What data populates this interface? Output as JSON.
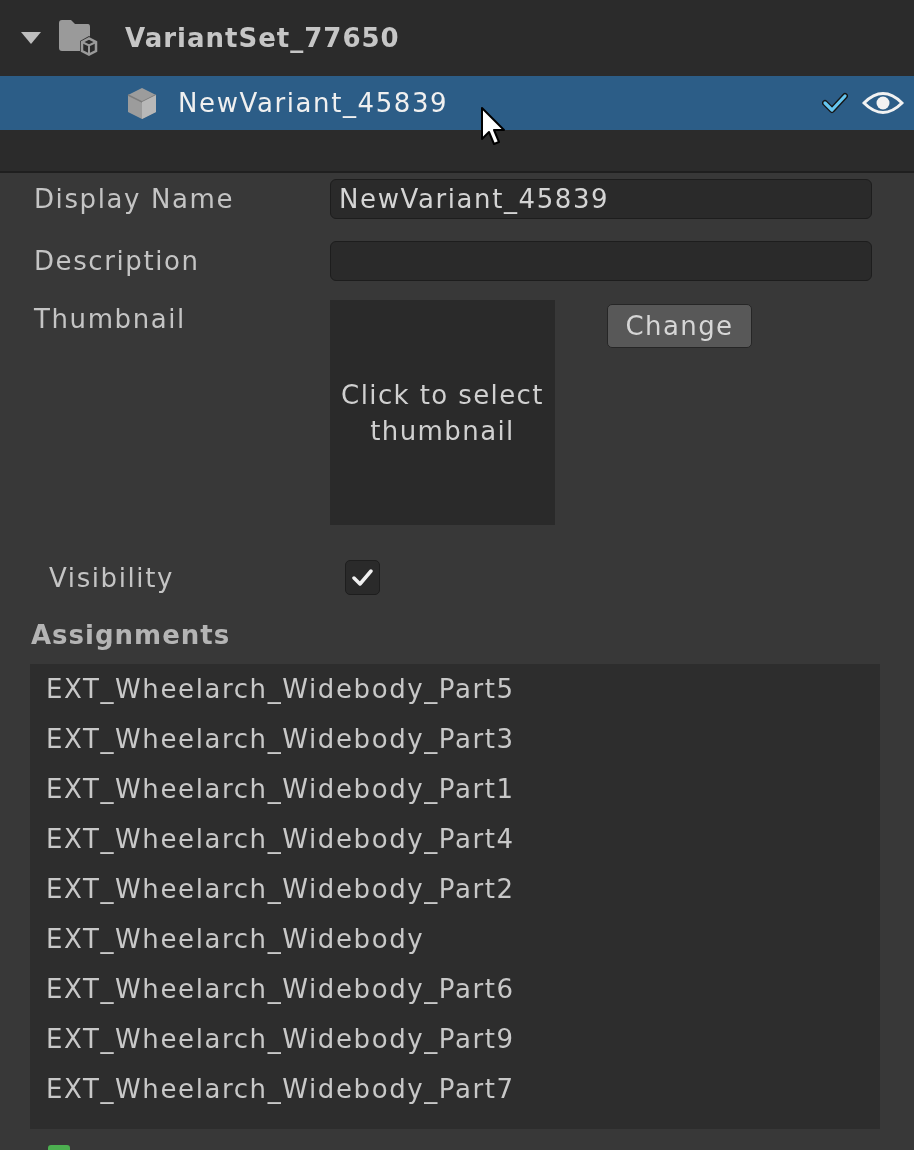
{
  "tree": {
    "items": [
      {
        "label": "VariantSet_77650",
        "kind": "variant_set",
        "expanded": true,
        "selected": false,
        "children": [
          {
            "label": "NewVariant_45839",
            "kind": "variant",
            "selected": true,
            "active": true,
            "visible": true
          }
        ]
      }
    ]
  },
  "inspector": {
    "fields": [
      {
        "kind": "text",
        "label": "Display Name",
        "value": "NewVariant_45839"
      },
      {
        "kind": "text",
        "label": "Description"
      },
      {
        "kind": "thumbnail",
        "label": "Thumbnail",
        "hint": "Click to select thumbnail",
        "button": "Change"
      },
      {
        "kind": "checkbox",
        "label": "Visibility",
        "checked": true
      }
    ]
  },
  "assignments": {
    "title": "Assignments",
    "items": [
      "EXT_Wheelarch_Widebody_Part5",
      "EXT_Wheelarch_Widebody_Part3",
      "EXT_Wheelarch_Widebody_Part1",
      "EXT_Wheelarch_Widebody_Part4",
      "EXT_Wheelarch_Widebody_Part2",
      "EXT_Wheelarch_Widebody",
      "EXT_Wheelarch_Widebody_Part6",
      "EXT_Wheelarch_Widebody_Part9",
      "EXT_Wheelarch_Widebody_Part7"
    ]
  }
}
